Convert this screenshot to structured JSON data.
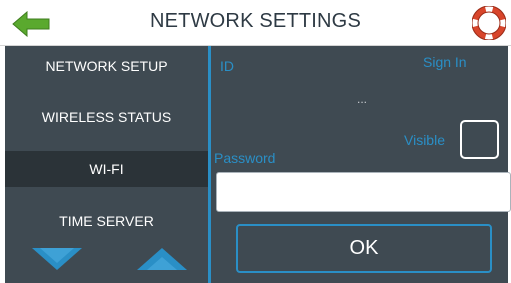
{
  "header": {
    "title": "NETWORK SETTINGS",
    "back_icon": "arrow-left-icon",
    "help_icon": "lifebuoy-icon"
  },
  "sidebar": {
    "items": [
      {
        "label": "NETWORK SETUP",
        "active": false
      },
      {
        "label": "WIRELESS STATUS",
        "active": false
      },
      {
        "label": "WI-FI",
        "active": true
      },
      {
        "label": "TIME SERVER",
        "active": false
      }
    ],
    "scroll_down_icon": "triangle-down-icon",
    "scroll_up_icon": "triangle-up-icon"
  },
  "form": {
    "id_label": "ID",
    "sign_in_label": "Sign In",
    "id_value": "...",
    "visible_label": "Visible",
    "password_label": "Password",
    "password_value": "",
    "ok_label": "OK"
  },
  "colors": {
    "accent": "#2a8fc6",
    "panel": "#3f4a52",
    "active_item": "#2b3338",
    "back_arrow": "#5aa92e",
    "lifebuoy_red": "#d8452b"
  }
}
